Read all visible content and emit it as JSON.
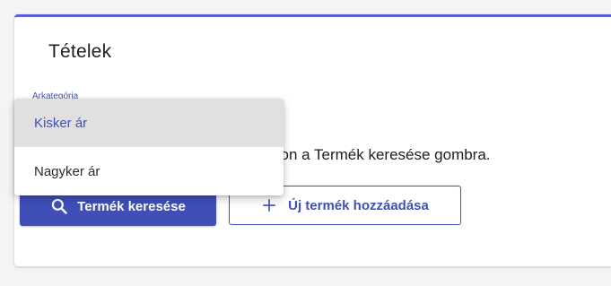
{
  "card": {
    "title": "Tételek",
    "field_label": "Arkategória"
  },
  "hint_text": "son a Termék keresése gombra.",
  "buttons": {
    "search_label": "Termék keresése",
    "add_label": "Új termék hozzáadása"
  },
  "dropdown": {
    "options": [
      {
        "label": "Kisker ár",
        "selected": true
      },
      {
        "label": "Nagyker ár",
        "selected": false
      }
    ]
  },
  "icons": {
    "search": "search-icon",
    "add": "plus-icon"
  },
  "colors": {
    "primary": "#3f4fb7",
    "accent_border": "#5b5fd6",
    "selected_bg": "#e0e0e0"
  }
}
